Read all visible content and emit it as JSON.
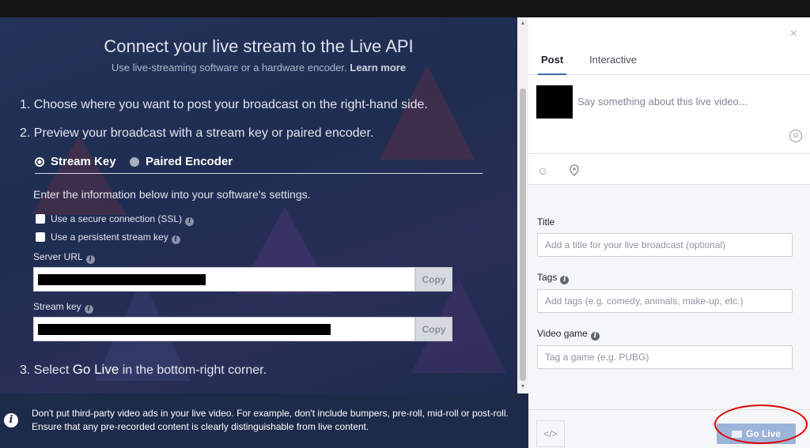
{
  "left": {
    "title": "Connect your live stream to the Live API",
    "subtitle": "Use live-streaming software or a hardware encoder.",
    "learn_more": "Learn more",
    "step1": "1. Choose where you want to post your broadcast on the right-hand side.",
    "step2": "2. Preview your broadcast with a stream key or paired encoder.",
    "radio_stream_key": "Stream Key",
    "radio_paired_encoder": "Paired Encoder",
    "info_line": "Enter the information below into your software's settings.",
    "checkbox_ssl": "Use a secure connection (SSL)",
    "checkbox_persistent": "Use a persistent stream key",
    "server_url_label": "Server URL",
    "stream_key_label": "Stream key",
    "copy_label": "Copy",
    "step3_prefix": "3. Select ",
    "step3_bold": "Go Live",
    "step3_suffix": " in the bottom-right corner."
  },
  "banner": {
    "text": "Don't put third-party video ads in your live video. For example, don't include bumpers, pre-roll, mid-roll or post-roll. Ensure that any pre-recorded content is clearly distinguishable from live content."
  },
  "right": {
    "close": "×",
    "tabs": [
      {
        "label": "Post"
      },
      {
        "label": "Interactive"
      }
    ],
    "composer_placeholder": "Say something about this live video...",
    "title_label": "Title",
    "title_placeholder": "Add a title for your live broadcast (optional)",
    "tags_label": "Tags",
    "tags_placeholder": "Add tags (e.g. comedy, animals, make-up, etc.)",
    "game_label": "Video game",
    "game_placeholder": "Tag a game (e.g. PUBG)",
    "embed_label": "</>",
    "go_live_label": "Go Live"
  },
  "colors": {
    "accent": "#4267b2",
    "go_live_disabled": "#9cb4d8",
    "highlight_oval": "#e00000",
    "panel_bg": "#25335a"
  }
}
